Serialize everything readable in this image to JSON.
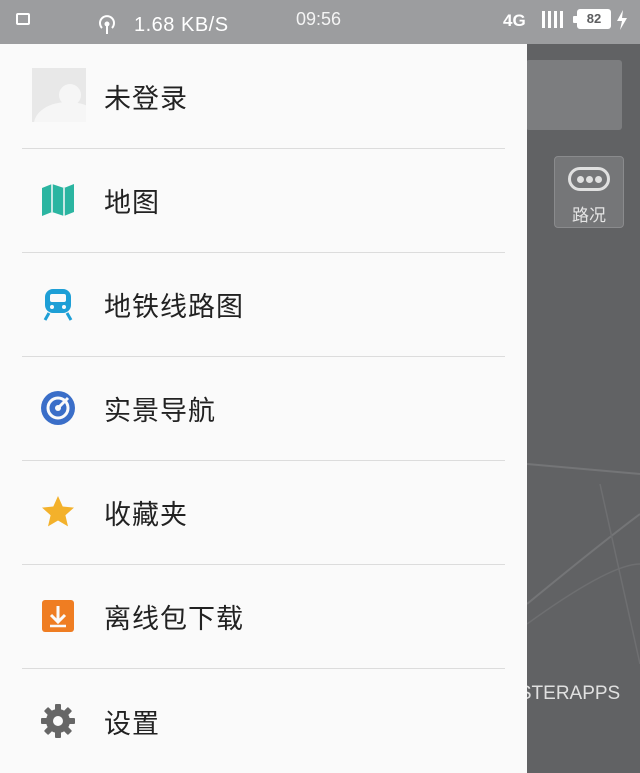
{
  "status_bar": {
    "speed": "1.68 KB/S",
    "time": "09:56",
    "network": "4G",
    "battery": "82",
    "icons": [
      "image-icon",
      "hotspot-icon",
      "signal-icon",
      "battery-icon",
      "charging-bolt-icon"
    ]
  },
  "drawer": {
    "user": {
      "label": "未登录",
      "icon": "avatar-placeholder"
    },
    "items": [
      {
        "label": "地图",
        "icon": "map-icon",
        "color": "#2bb5a1"
      },
      {
        "label": "地铁线路图",
        "icon": "subway-icon",
        "color": "#1e9fd6"
      },
      {
        "label": "实景导航",
        "icon": "radar-icon",
        "color": "#3a6ec8"
      },
      {
        "label": "收藏夹",
        "icon": "star-icon",
        "color": "#f3b12b"
      },
      {
        "label": "离线包下载",
        "icon": "download-icon",
        "color": "#ef7d22"
      },
      {
        "label": "设置",
        "icon": "gear-icon",
        "color": "#666666"
      }
    ]
  },
  "map": {
    "traffic_button_label": "路况"
  },
  "watermark": "TASTERAPPS"
}
